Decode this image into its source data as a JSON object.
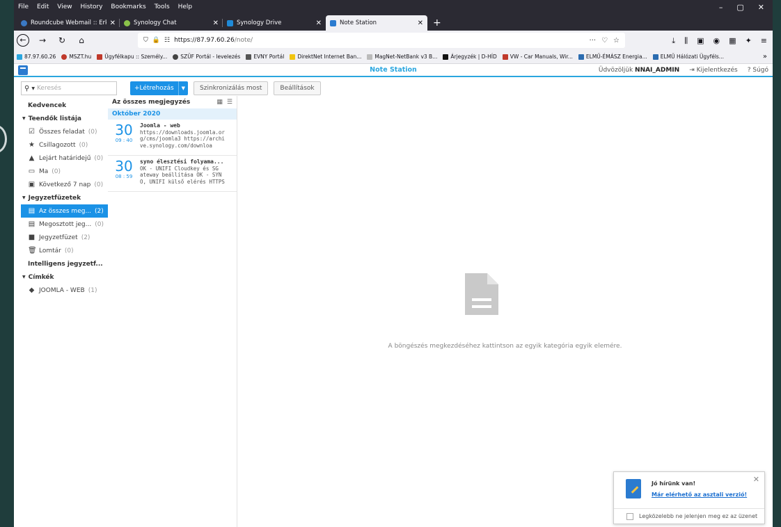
{
  "menu": [
    "File",
    "Edit",
    "View",
    "History",
    "Bookmarks",
    "Tools",
    "Help"
  ],
  "tabs": [
    {
      "title": "Roundcube Webmail :: Érkezett",
      "color": "#3b79c4"
    },
    {
      "title": "Synology Chat",
      "color": "#8bc34a"
    },
    {
      "title": "Synology Drive",
      "color": "#1f8ad8"
    },
    {
      "title": "Note Station",
      "color": "#2b7bd0"
    }
  ],
  "url": {
    "host": "https://87.97.60.26",
    "path": "/note/",
    "dots": "···"
  },
  "bookmarks": [
    {
      "label": "87.97.60.26",
      "color": "#2aa6df"
    },
    {
      "label": "MSZT.hu",
      "color": "#c0392b"
    },
    {
      "label": "Ügyfélkapu :: Személy...",
      "color": "#c0392b"
    },
    {
      "label": "SZÜF Portál - levelezés",
      "color": "#444"
    },
    {
      "label": "EVNY Portál",
      "color": "#555"
    },
    {
      "label": "DirektNet Internet Ban...",
      "color": "#f1c40f"
    },
    {
      "label": "MagNet-NetBank v3 B...",
      "color": "#bbb"
    },
    {
      "label": "Árjegyzék | D-HÍD",
      "color": "#111"
    },
    {
      "label": "VW - Car Manuals, Wir...",
      "color": "#c0392b"
    },
    {
      "label": "ELMŰ-ÉMÁSZ Energia...",
      "color": "#2b6cb0"
    },
    {
      "label": "ELMŰ Hálózati Ügyféls...",
      "color": "#2b6cb0"
    }
  ],
  "app": {
    "title": "Note Station",
    "welcome": "Üdvözöljük",
    "user": "NNAI_ADMIN",
    "logout": "Kijelentkezés",
    "help": "Súgó"
  },
  "toolbar": {
    "search_placeholder": "Keresés",
    "create": "Létrehozás",
    "sync": "Szinkronizálás most",
    "settings": "Beállítások"
  },
  "sidebar": {
    "favorites": "Kedvencek",
    "todo_head": "Teendők listája",
    "todo": [
      {
        "label": "Összes feladat",
        "count": "(0)"
      },
      {
        "label": "Csillagozott",
        "count": "(0)"
      },
      {
        "label": "Lejárt határidejű",
        "count": "(0)"
      },
      {
        "label": "Ma",
        "count": "(0)"
      },
      {
        "label": "Következő 7 nap",
        "count": "(0)"
      }
    ],
    "notebooks_head": "Jegyzetfüzetek",
    "notebooks": [
      {
        "label": "Az összes meg...",
        "count": "(2)"
      },
      {
        "label": "Megosztott jeg...",
        "count": "(0)"
      },
      {
        "label": "Jegyzetfüzet",
        "count": "(2)"
      },
      {
        "label": "Lomtár",
        "count": "(0)"
      }
    ],
    "smart": "Intelligens jegyzetf...",
    "tags_head": "Címkék",
    "tags": [
      {
        "label": "JOOMLA - WEB",
        "count": "(1)"
      }
    ]
  },
  "notes": {
    "header": "Az összes megjegyzés",
    "month": "Október 2020",
    "items": [
      {
        "day": "30",
        "time": "09 : 40",
        "title": "Joomla - web",
        "l1": "https://downloads.joomla.or",
        "l2": "g/cms/joomla3 https://archi",
        "l3": "ve.synology.com/downloa"
      },
      {
        "day": "30",
        "time": "08 : 59",
        "title": "syno élesztési folyama...",
        "l1": "OK - UNIFI Cloudkey és SG",
        "l2": "ateway beállítása OK - SYN",
        "l3": "O, UNIFI külső elérés HTTPS"
      }
    ]
  },
  "content": {
    "empty": "A böngészés megkezdéséhez kattintson az egyik kategória egyik elemére."
  },
  "popup": {
    "title": "Jó hírünk van!",
    "link": "Már elérhető az asztali verzió!",
    "checkbox": "Legközelebb ne jelenjen meg ez az üzenet"
  }
}
